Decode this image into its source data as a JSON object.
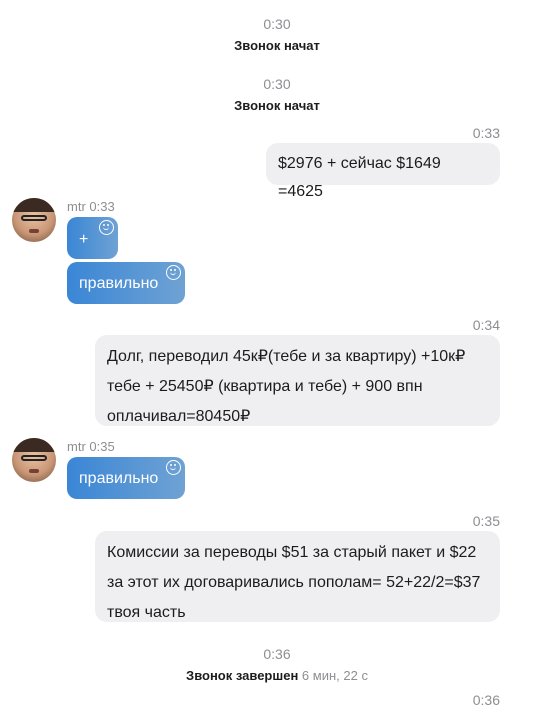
{
  "system_events": [
    {
      "time": "0:30",
      "label": "Звонок начат"
    },
    {
      "time": "0:30",
      "label": "Звонок начат"
    },
    {
      "time": "0:36",
      "label": "Звонок завершен",
      "duration": "6 мин, 22 с"
    }
  ],
  "messages": [
    {
      "time": "0:33",
      "text": "$2976  + сейчас $1649 =4625"
    },
    {
      "sender": "mtr",
      "time": "0:33",
      "bubbles": [
        "+",
        "правильно"
      ]
    },
    {
      "time": "0:34",
      "lines": [
        "Долг, переводил 45к₽(тебе и за квартиру) +10к₽",
        "тебе + 25450₽ (квартира и тебе) + 900 впн",
        "оплачивал=80450₽"
      ]
    },
    {
      "sender": "mtr",
      "time": "0:35",
      "bubbles": [
        "правильно"
      ]
    },
    {
      "time": "0:35",
      "lines": [
        "Комиссии за переводы $51 за старый  пакет и $22",
        "за этот их договаривались пополам= 52+22/2=$37",
        "твоя часть"
      ]
    }
  ],
  "partial_timestamp": "0:36"
}
